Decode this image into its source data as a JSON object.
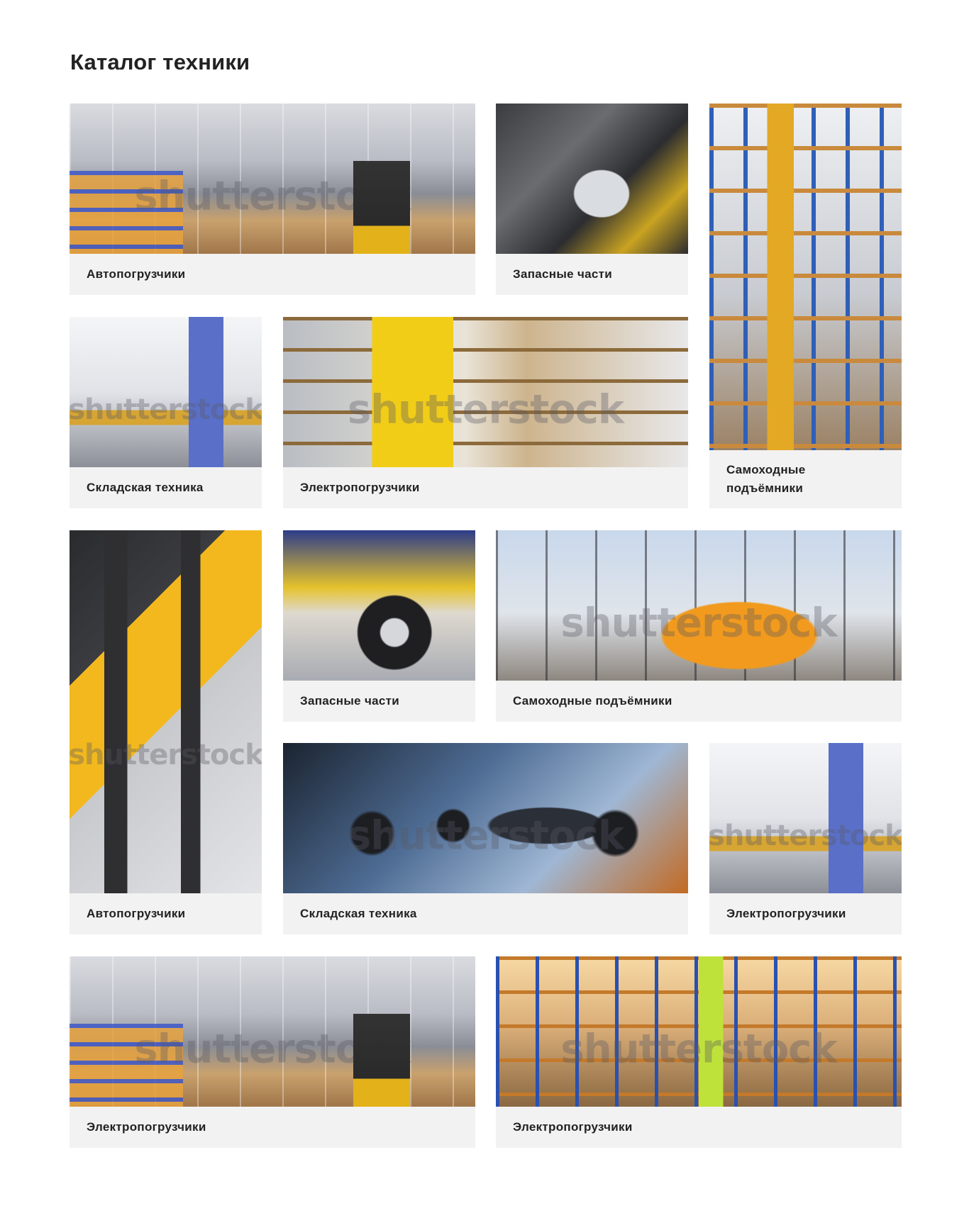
{
  "heading": "Каталог техники",
  "watermark": "shutterstock",
  "cards": [
    {
      "label": "Автопогрузчики"
    },
    {
      "label": "Запасные части"
    },
    {
      "label": "Самоходные подъёмники"
    },
    {
      "label": "Складская техника"
    },
    {
      "label": "Электропогрузчики"
    },
    {
      "label": "Автопогрузчики"
    },
    {
      "label": "Запасные части"
    },
    {
      "label": "Самоходные подъёмники"
    },
    {
      "label": "Складская техника"
    },
    {
      "label": "Электропогрузчики"
    },
    {
      "label": "Электропогрузчики"
    },
    {
      "label": "Электропогрузчики"
    }
  ]
}
